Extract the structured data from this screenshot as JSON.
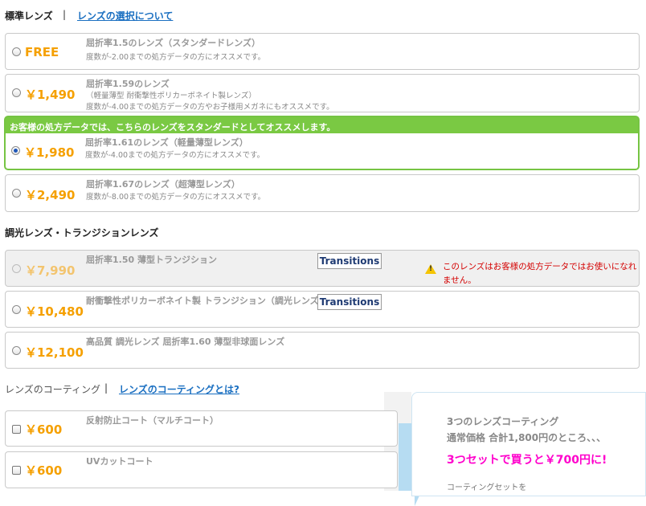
{
  "standard": {
    "title": "標準レンズ",
    "separator": "|",
    "link": "レンズの選択について",
    "options": [
      {
        "price": "FREE",
        "title": "屈折率1.5のレンズ（スタンダードレンズ）",
        "desc": [
          "度数が-2.00までの処方データの方にオススメです。"
        ],
        "checked": false
      },
      {
        "price": "￥1,490",
        "title": "屈折率1.59のレンズ",
        "desc": [
          "（軽量薄型 耐衝撃性ポリカーボネイト製レンズ）",
          "度数が-4.00までの処方データの方やお子様用メガネにもオススメです。"
        ],
        "checked": false
      },
      {
        "price": "￥1,980",
        "title": "屈折率1.61のレンズ（軽量薄型レンズ）",
        "desc": [
          "度数が-4.00までの処方データの方にオススメです。"
        ],
        "checked": true
      },
      {
        "price": "￥2,490",
        "title": "屈折率1.67のレンズ（超薄型レンズ）",
        "desc": [
          "度数が-8.00までの処方データの方にオススメです。"
        ],
        "checked": false
      }
    ],
    "recommend_banner": "お客様の処方データでは、こちらのレンズをスタンダードとしてオススメします。"
  },
  "transition": {
    "title": "調光レンズ・トランジションレンズ",
    "options": [
      {
        "price": "￥7,990",
        "title": "屈折率1.50 薄型トランジション",
        "logo": "Transitions",
        "disabled": true
      },
      {
        "price": "￥10,480",
        "title": "耐衝撃性ポリカーボネイト製 トランジション（調光レンズ）",
        "logo": "Transitions",
        "disabled": false
      },
      {
        "price": "￥12,100",
        "title": "高品質 調光レンズ 屈折率1.60 薄型非球面レンズ",
        "disabled": false
      }
    ],
    "warning": "このレンズはお客様の処方データではお使いになれません。"
  },
  "coating": {
    "title": "レンズのコーティング",
    "separator": "|",
    "link": "レンズのコーティングとは?",
    "options": [
      {
        "price": "￥600",
        "title": "反射防止コート（マルチコート）"
      },
      {
        "price": "￥600",
        "title": "UVカットコート"
      }
    ],
    "promo": {
      "line1": "3つのレンズコーティング",
      "line2": "通常価格 合計1,800円のところ、、、",
      "line3": "3つセットで買うと￥700円に!",
      "line4": "コーティングセットを"
    }
  },
  "colors": {
    "price": "#f5a000",
    "recommend_green": "#7ac943",
    "link": "#1a6fc1",
    "warning": "#d40000",
    "promo_pink": "#ff00cc"
  }
}
